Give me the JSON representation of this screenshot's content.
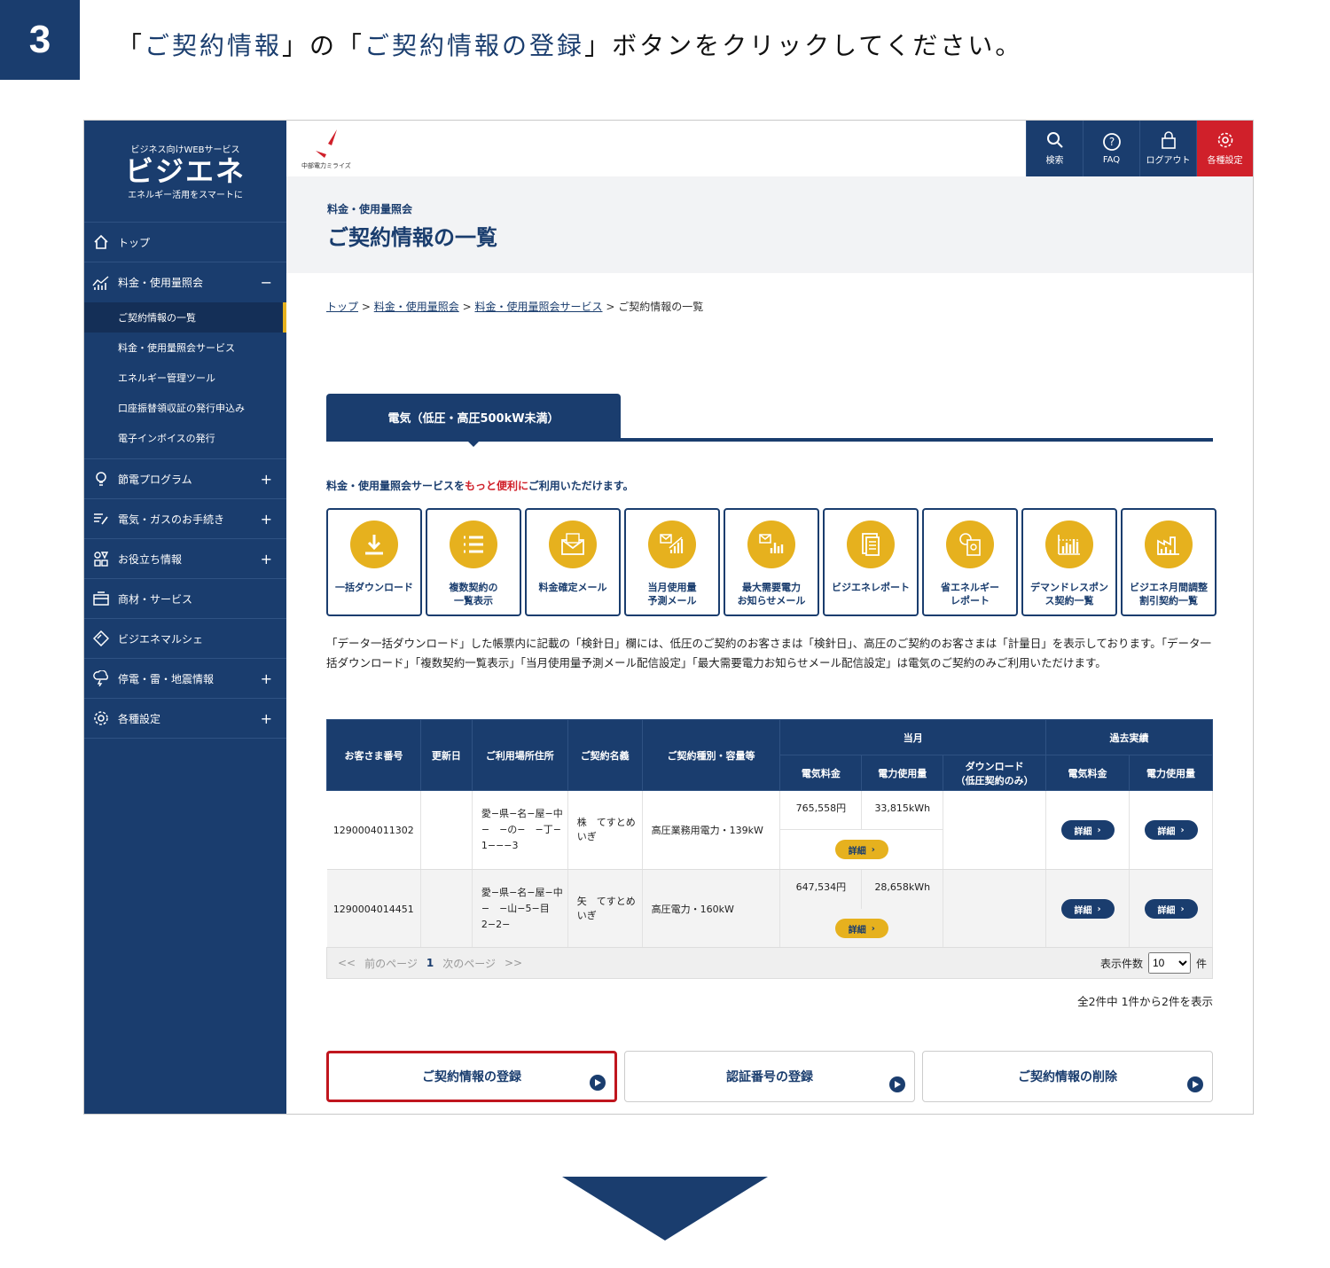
{
  "step": {
    "number": "3",
    "open1": "「",
    "hl1": "ご契約情報",
    "mid": "」の「",
    "hl2": "ご契約情報の登録",
    "rest": "」ボタンをクリックしてください。"
  },
  "sidebar": {
    "logo_top": "ビジネス向けWEBサービス",
    "logo_main": "ビジエネ",
    "logo_sub": "エネルギー活用をスマートに",
    "items": [
      {
        "label": "トップ",
        "icon": "home-icon"
      },
      {
        "label": "料金・使用量照会",
        "icon": "chart-icon",
        "toggle": "−"
      },
      {
        "label": "節電プログラム",
        "icon": "bulb-icon",
        "toggle": "+"
      },
      {
        "label": "電気・ガスのお手続き",
        "icon": "edit-list-icon",
        "toggle": "+"
      },
      {
        "label": "お役立ち情報",
        "icon": "grid-icon",
        "toggle": "+"
      },
      {
        "label": "商材・サービス",
        "icon": "store-icon"
      },
      {
        "label": "ビジエネマルシェ",
        "icon": "tag-icon"
      },
      {
        "label": "停電・雷・地震情報",
        "icon": "storm-icon",
        "toggle": "+"
      },
      {
        "label": "各種設定",
        "icon": "gear-icon",
        "toggle": "+"
      }
    ],
    "subitems": [
      "ご契約情報の一覧",
      "料金・使用量照会サービス",
      "エネルギー管理ツール",
      "口座振替領収証の発行申込み",
      "電子インボイスの発行"
    ]
  },
  "brand_caption": "中部電力ミライズ",
  "topbar": {
    "search": "検索",
    "faq": "FAQ",
    "logout": "ログアウト",
    "settings": "各種設定"
  },
  "page": {
    "category": "料金・使用量照会",
    "title": "ご契約情報の一覧"
  },
  "breadcrumb": {
    "c1": "トップ",
    "c2": "料金・使用量照会",
    "c3": "料金・使用量照会サービス",
    "current": "ご契約情報の一覧",
    "sep": ">"
  },
  "tab": "電気（低圧・高圧500kW未満）",
  "promo": {
    "a": "料金・使用量照会サービスを",
    "b": "もっと便利に",
    "c": "ご利用いただけます。"
  },
  "features": [
    {
      "l1": "一括ダウンロード",
      "l2": "",
      "icon": "download-icon"
    },
    {
      "l1": "複数契約の",
      "l2": "一覧表示",
      "icon": "list-icon"
    },
    {
      "l1": "料金確定メール",
      "l2": "",
      "icon": "mail-icon"
    },
    {
      "l1": "当月使用量",
      "l2": "予測メール",
      "icon": "mail-chart-icon"
    },
    {
      "l1": "最大需要電力",
      "l2": "お知らせメール",
      "icon": "mail-bars-icon"
    },
    {
      "l1": "ビジエネレポート",
      "l2": "",
      "icon": "report-icon"
    },
    {
      "l1": "省エネルギー",
      "l2": "レポート",
      "icon": "eco-report-icon"
    },
    {
      "l1": "デマンドレスポン",
      "l2": "ス契約一覧",
      "icon": "demand-chart-icon"
    },
    {
      "l1": "ビジエネ月間調整",
      "l2": "割引契約一覧",
      "icon": "factory-icon"
    }
  ],
  "notice": "「データ一括ダウンロード」した帳票内に記載の「検針日」欄には、低圧のご契約のお客さまは「検針日」、高圧のご契約のお客さまは「計量日」を表示しております。「データ一括ダウンロード」「複数契約一覧表示」「当月使用量予測メール配信設定」「最大需要電力お知らせメール配信設定」は電気のご契約のみご利用いただけます。",
  "table": {
    "headers": {
      "customer_no": "お客さま番号",
      "renewal": "更新日",
      "address": "ご利用場所住所",
      "holder": "ご契約名義",
      "type": "ご契約種別・容量等",
      "current": "当月",
      "past": "過去実績",
      "fee": "電気料金",
      "usage": "電力使用量",
      "download": "ダウンロード",
      "download2": "（低圧契約のみ）",
      "fee2": "電気料金",
      "usage2": "電力使用量"
    },
    "rows": [
      {
        "no": "1290004011302",
        "renewal": "",
        "addr1": "愛−県−名−屋−中",
        "addr2": "−　−の−　−丁−",
        "addr3": "1−−−3",
        "holder1": "株　てすとめ",
        "holder2": "いぎ",
        "type": "高圧業務用電力・139kW",
        "fee": "765,558円",
        "usage": "33,815kWh",
        "detail": "詳細"
      },
      {
        "no": "1290004014451",
        "renewal": "",
        "addr1": "愛−県−名−屋−中",
        "addr2": "−　−山−5−目",
        "addr3": "2−2−",
        "holder1": "矢　てすとめ",
        "holder2": "いぎ",
        "type": "高圧電力・160kW",
        "fee": "647,534円",
        "usage": "28,658kWh",
        "detail": "詳細"
      }
    ]
  },
  "pager": {
    "first": "<<",
    "prev": "前のページ",
    "current": "1",
    "next": "次のページ",
    "last": ">>",
    "per_page_label": "表示件数",
    "per_page": "10",
    "unit": "件"
  },
  "summary": "全2件中 1件から2件を表示",
  "actions": {
    "register": "ご契約情報の登録",
    "auth": "認証番号の登録",
    "delete": "ご契約情報の削除"
  },
  "colors": {
    "navy": "#1a3d6e",
    "accent": "#e6b11e",
    "red": "#d0202a"
  }
}
